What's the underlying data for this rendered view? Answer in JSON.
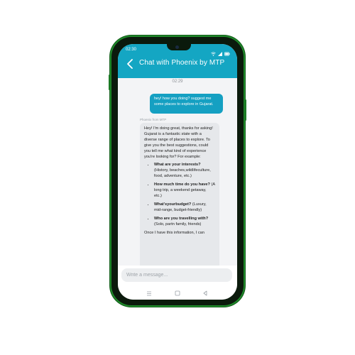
{
  "status_bar": {
    "time": "02:30",
    "icons": [
      "wifi-icon",
      "signal-icon",
      "battery-icon"
    ]
  },
  "header": {
    "title": "Chat with Phoenix by MTP",
    "background_color": "#14a6c3"
  },
  "chat": {
    "timestamp": "02:29",
    "user_message": "hey! how you doing? suggest me some places to explore in Gujarat.",
    "bot_sender": "Phoenix from MTP",
    "bot_intro": "Hey! I'm doing great, thanks for asking! Gujarat is a fantastic state with a diverse range of places to explore. To give you the best suggestions, could you tell me what kind of experience you're looking for? For example:",
    "bot_list": [
      {
        "question": "What are your interests?",
        "detail": "(History, beaches,wildlifeculture, food, adventure, etc.)"
      },
      {
        "question": "How much time do you have?",
        "detail": "(A long trip, a weekend getaway, etc.)"
      },
      {
        "question": "What'syourbudget?",
        "detail": "(Luxury, mid-range, budget-friendly)"
      },
      {
        "question": "Who are you travelling with?",
        "detail": "(Solo, partn family, friends)"
      }
    ],
    "bot_outro": "Once I have this information, I can",
    "user_bubble_color": "#15a0c2"
  },
  "input": {
    "placeholder": "Write a message..."
  },
  "nav_icons": [
    "menu-icon",
    "home-icon",
    "back-nav-icon"
  ]
}
